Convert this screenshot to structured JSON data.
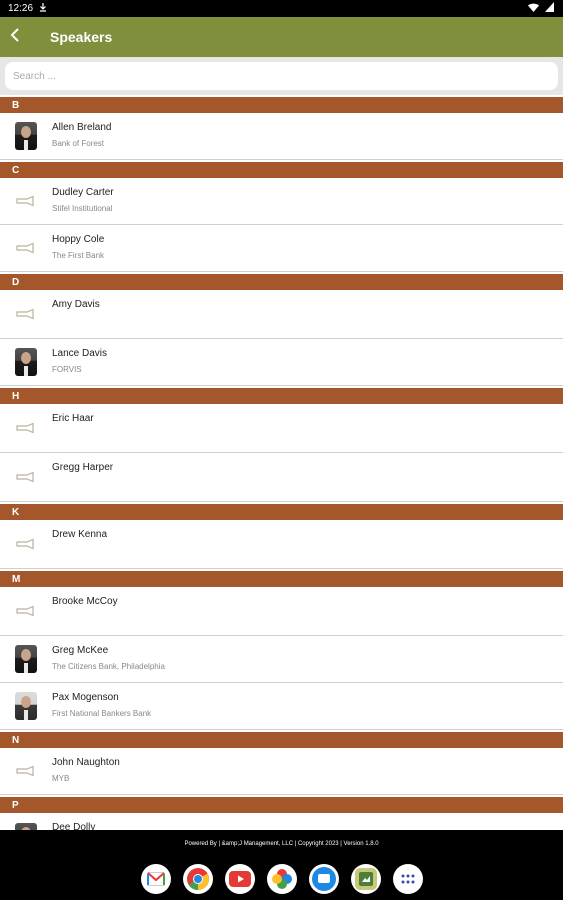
{
  "status": {
    "time": "12:26"
  },
  "app_bar": {
    "title": "Speakers"
  },
  "search": {
    "placeholder": "Search ..."
  },
  "sections": [
    {
      "letter": "B",
      "rows": [
        {
          "name": "Allen Breland",
          "org": "Bank of Forest",
          "avatar": "photo"
        }
      ]
    },
    {
      "letter": "C",
      "rows": [
        {
          "name": "Dudley Carter",
          "org": "Stifel Institutional",
          "avatar": "placeholder"
        },
        {
          "name": "Hoppy Cole",
          "org": "The First Bank",
          "avatar": "placeholder"
        }
      ]
    },
    {
      "letter": "D",
      "rows": [
        {
          "name": "Amy Davis",
          "org": "",
          "avatar": "placeholder"
        },
        {
          "name": "Lance Davis",
          "org": "FORVIS",
          "avatar": "photo"
        }
      ]
    },
    {
      "letter": "H",
      "rows": [
        {
          "name": "Eric Haar",
          "org": "",
          "avatar": "placeholder"
        },
        {
          "name": "Gregg Harper",
          "org": "",
          "avatar": "placeholder"
        }
      ]
    },
    {
      "letter": "K",
      "rows": [
        {
          "name": "Drew Kenna",
          "org": "",
          "avatar": "placeholder"
        }
      ]
    },
    {
      "letter": "M",
      "rows": [
        {
          "name": "Brooke McCoy",
          "org": "",
          "avatar": "placeholder"
        },
        {
          "name": "Greg McKee",
          "org": "The Citizens Bank, Philadelphia",
          "avatar": "photo"
        },
        {
          "name": "Pax Mogenson",
          "org": "First National Bankers Bank",
          "avatar": "photo"
        }
      ]
    },
    {
      "letter": "N",
      "rows": [
        {
          "name": "John Naughton",
          "org": "MYB",
          "avatar": "placeholder"
        }
      ]
    },
    {
      "letter": "P",
      "rows": [
        {
          "name": "Dee Dolly",
          "org": "",
          "avatar": "photo"
        }
      ]
    }
  ],
  "footer": {
    "text": "Powered By | &amp;J Management, LLC | Copyright 2023 | Version 1.8.0"
  },
  "dock": {
    "apps": [
      "gmail-icon",
      "chrome-icon",
      "youtube-icon",
      "photos-icon",
      "messages-icon",
      "pics-icon",
      "app-drawer-icon"
    ]
  },
  "colors": {
    "app_bar": "#7f8f3b",
    "section_header": "#a4572a"
  }
}
